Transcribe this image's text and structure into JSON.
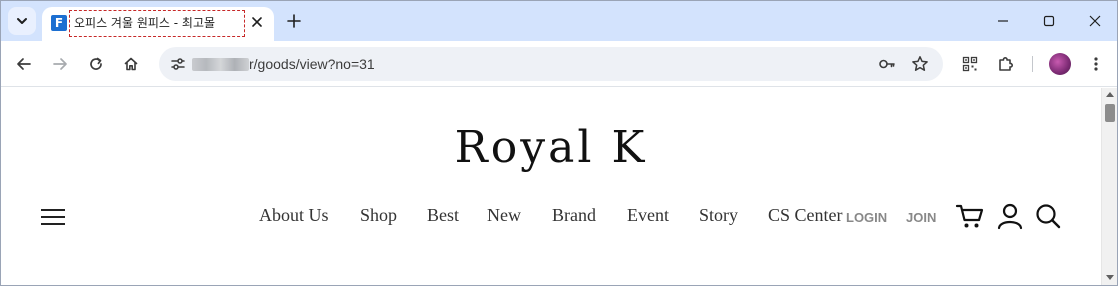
{
  "browser": {
    "tab": {
      "favicon_letter": "F",
      "title": "오피스 겨울 원피스 - 최고몰"
    },
    "address_bar": {
      "url_visible": "r/goods/view?no=31"
    }
  },
  "site": {
    "logo": "Royal K",
    "nav": [
      "About Us",
      "Shop",
      "Best",
      "New",
      "Brand",
      "Event",
      "Story",
      "CS Center"
    ],
    "account_links": {
      "login": "LOGIN",
      "join": "JOIN"
    }
  },
  "icons": {
    "tab_search": "chevron-down-icon",
    "tab_close": "close-icon",
    "new_tab": "plus-icon",
    "minimize": "minimize-icon",
    "maximize": "maximize-icon",
    "close_window": "close-icon",
    "back": "arrow-left-icon",
    "forward": "arrow-right-icon",
    "reload": "reload-icon",
    "home": "home-icon",
    "site_info": "tune-icon",
    "password": "key-icon",
    "bookmark": "star-icon",
    "qr": "qr-code-icon",
    "extensions": "puzzle-icon",
    "profile": "avatar",
    "menu": "more-vertical-icon",
    "hamburger": "hamburger-menu-icon",
    "cart": "cart-icon",
    "user": "user-icon",
    "search": "search-icon"
  },
  "colors": {
    "tabstrip_bg": "#d3e3fd",
    "omnibox_bg": "#eef1f6",
    "favicon_bg": "#1c6fd1",
    "tab_title_outline": "#c62828"
  }
}
